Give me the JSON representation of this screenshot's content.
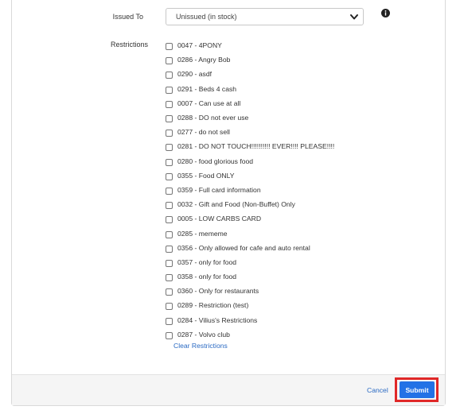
{
  "form": {
    "issued_to_label": "Issued To",
    "issued_to_value": "Unissued (in stock)",
    "restrictions_label": "Restrictions",
    "restrictions": [
      {
        "label": "0047 - 4PONY",
        "checked": false
      },
      {
        "label": "0286 - Angry Bob",
        "checked": false
      },
      {
        "label": "0290 - asdf",
        "checked": false
      },
      {
        "label": "0291 - Beds 4 cash",
        "checked": false
      },
      {
        "label": "0007 - Can use at all",
        "checked": false
      },
      {
        "label": "0288 - DO not ever use",
        "checked": false
      },
      {
        "label": "0277 - do not sell",
        "checked": false
      },
      {
        "label": "0281 - DO NOT TOUCH!!!!!!!!!! EVER!!!! PLEASE!!!!",
        "checked": false
      },
      {
        "label": "0280 - food glorious food",
        "checked": false
      },
      {
        "label": "0355 - Food ONLY",
        "checked": false
      },
      {
        "label": "0359 - Full card information",
        "checked": false
      },
      {
        "label": "0032 - Gift and Food (Non-Buffet) Only",
        "checked": false
      },
      {
        "label": "0005 - LOW CARBS CARD",
        "checked": false
      },
      {
        "label": "0285 - mememe",
        "checked": false
      },
      {
        "label": "0356 - Only allowed for cafe and auto rental",
        "checked": false
      },
      {
        "label": "0357 - only for food",
        "checked": false
      },
      {
        "label": "0358 - only for food",
        "checked": false
      },
      {
        "label": "0360 - Only for restaurants",
        "checked": false
      },
      {
        "label": "0289 - Restriction (test)",
        "checked": false
      },
      {
        "label": "0284 - Vilius's Restrictions",
        "checked": false
      },
      {
        "label": "0287 - Volvo club",
        "checked": false
      }
    ],
    "clear_restrictions_label": "Clear Restrictions"
  },
  "footer": {
    "cancel_label": "Cancel",
    "submit_label": "Submit"
  },
  "icons": {
    "select_arrow": "chevron-down-icon",
    "info": "info-icon"
  },
  "colors": {
    "link": "#2a6ac3",
    "submit_bg": "#2372e6",
    "highlight": "#e02828"
  }
}
